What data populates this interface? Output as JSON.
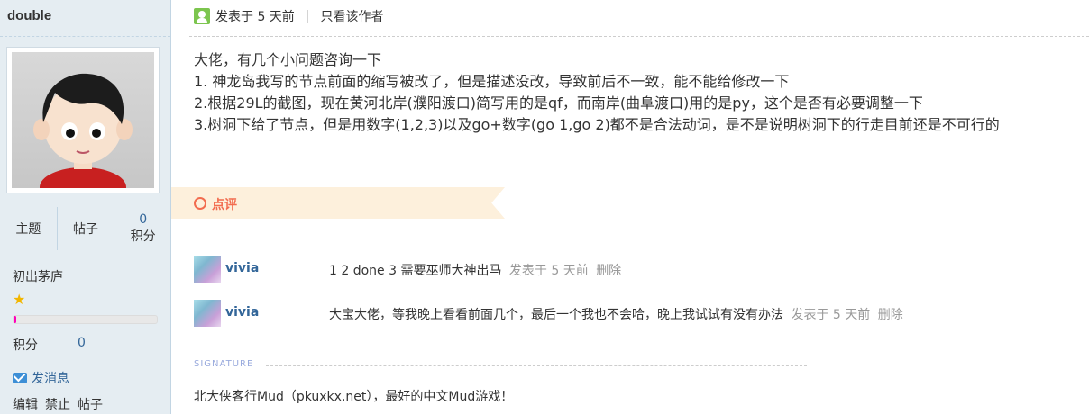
{
  "author": {
    "username": "double",
    "stats": [
      {
        "label": "主题",
        "value": ""
      },
      {
        "label": "帖子",
        "value": ""
      },
      {
        "label": "积分",
        "value": "0"
      }
    ],
    "group": "初出茅庐",
    "level_progress": 0.02,
    "points_label": "积分",
    "points_value": "0",
    "send_message": "发消息",
    "admin_links": [
      "编辑",
      "禁止",
      "帖子"
    ]
  },
  "post": {
    "meta_posted": "发表于 5 天前",
    "meta_only_author": "只看该作者",
    "lines": [
      "大佬，有几个小问题咨询一下",
      "1. 神龙岛我写的节点前面的缩写被改了，但是描述没改，导致前后不一致，能不能给修改一下",
      "2.根据29L的截图，现在黄河北岸(濮阳渡口)简写用的是qf，而南岸(曲阜渡口)用的是py，这个是否有必要调整一下",
      "3.树洞下给了节点，但是用数字(1,2,3)以及go+数字(go 1,go 2)都不是合法动词，是不是说明树洞下的行走目前还是不可行的"
    ]
  },
  "comments_section": {
    "label": "点评",
    "items": [
      {
        "user": "vivia",
        "text": "1 2 done 3 需要巫师大神出马",
        "time": "发表于 5 天前",
        "delete": "删除"
      },
      {
        "user": "vivia",
        "text": "大宝大佬，等我晚上看看前面几个，最后一个我也不会哈，晚上我试试有没有办法",
        "time": "发表于 5 天前",
        "delete": "删除"
      }
    ]
  },
  "signature": {
    "label": "SIGNATURE",
    "text": "北大侠客行Mud（pkuxkx.net），最好的中文Mud游戏！"
  },
  "colors": {
    "sidebar_bg": "#e5edf2",
    "link": "#336699",
    "accent": "#f26c4f",
    "comment_tab_bg": "#fdf0dc"
  }
}
